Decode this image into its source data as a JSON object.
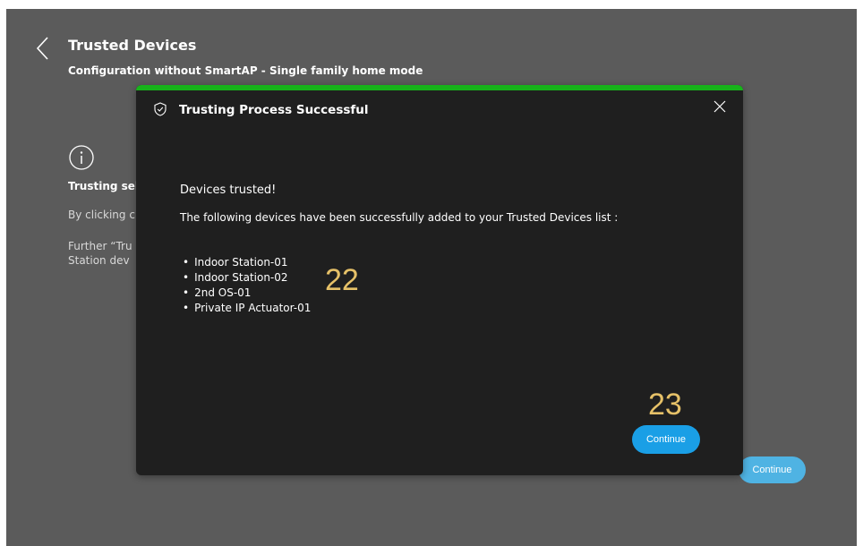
{
  "header": {
    "title": "Trusted Devices",
    "subtitle": "Configuration without SmartAP - Single family home mode"
  },
  "background": {
    "heading": "Trusting sel",
    "line1": "By clicking c",
    "line2": "Further “Tru",
    "line3": "Station dev",
    "continue_label": "Continue"
  },
  "dialog": {
    "title": "Trusting Process Successful",
    "heading": "Devices trusted!",
    "description": "The following devices have been successfully added to your Trusted Devices list :",
    "devices": [
      "Indoor Station-01",
      "Indoor Station-02",
      "2nd OS-01",
      "Private IP Actuator-01"
    ],
    "continue_label": "Continue"
  },
  "annotations": {
    "a22": "22",
    "a23": "23"
  },
  "colors": {
    "screen_bg": "#5b5b5b",
    "dialog_bg": "#1f1f1f",
    "success_bar": "#17b31a",
    "primary_button": "#1a9fe6",
    "annotation": "#e6c168"
  }
}
